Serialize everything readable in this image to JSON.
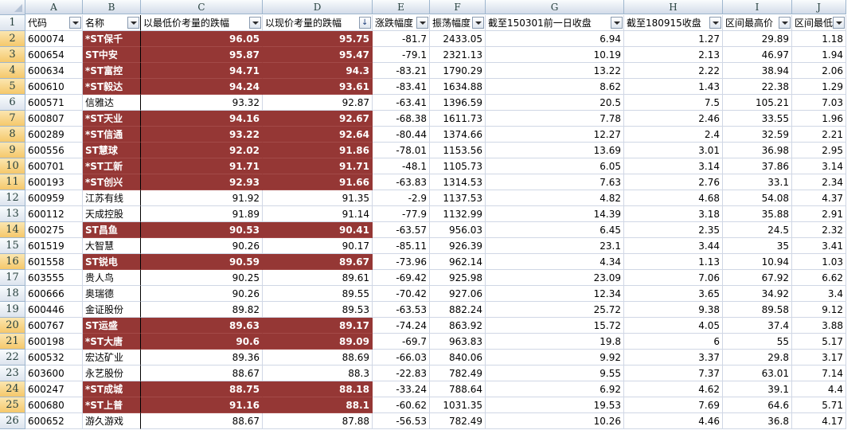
{
  "column_letters": [
    "A",
    "B",
    "C",
    "D",
    "E",
    "F",
    "G",
    "H",
    "I",
    "J"
  ],
  "headers": [
    "代码",
    "名称",
    "以最低价考量的跌幅",
    "以现价考量的跌幅",
    "涨跌幅度",
    "振荡幅度",
    "截至150301前一日收盘",
    "截至180915收盘",
    "区间最高价",
    "区间最低价"
  ],
  "header_row_number": "1",
  "sort_indicator": "↓",
  "highlight_color": "#953735",
  "rows": [
    {
      "n": "2",
      "hl": true,
      "cells": [
        "600074",
        "*ST保千",
        "96.05",
        "95.75",
        "-81.7",
        "2433.05",
        "6.94",
        "1.27",
        "29.89",
        "1.18"
      ]
    },
    {
      "n": "3",
      "hl": true,
      "cells": [
        "600654",
        "ST中安",
        "95.87",
        "95.47",
        "-79.1",
        "2321.13",
        "10.19",
        "2.13",
        "46.97",
        "1.94"
      ]
    },
    {
      "n": "4",
      "hl": true,
      "cells": [
        "600634",
        "*ST富控",
        "94.71",
        "94.3",
        "-83.21",
        "1790.29",
        "13.22",
        "2.22",
        "38.94",
        "2.06"
      ]
    },
    {
      "n": "5",
      "hl": true,
      "cells": [
        "600610",
        "*ST毅达",
        "94.24",
        "93.61",
        "-83.41",
        "1634.88",
        "8.62",
        "1.43",
        "22.38",
        "1.29"
      ]
    },
    {
      "n": "6",
      "hl": false,
      "cells": [
        "600571",
        "信雅达",
        "93.32",
        "92.87",
        "-63.41",
        "1396.59",
        "20.5",
        "7.5",
        "105.21",
        "7.03"
      ]
    },
    {
      "n": "7",
      "hl": true,
      "cells": [
        "600807",
        "*ST天业",
        "94.16",
        "92.67",
        "-68.38",
        "1611.73",
        "7.78",
        "2.46",
        "33.55",
        "1.96"
      ]
    },
    {
      "n": "8",
      "hl": true,
      "cells": [
        "600289",
        "*ST信通",
        "93.22",
        "92.64",
        "-80.44",
        "1374.66",
        "12.27",
        "2.4",
        "32.59",
        "2.21"
      ]
    },
    {
      "n": "9",
      "hl": true,
      "cells": [
        "600556",
        "ST慧球",
        "92.02",
        "91.86",
        "-78.01",
        "1153.56",
        "13.69",
        "3.01",
        "36.98",
        "2.95"
      ]
    },
    {
      "n": "10",
      "hl": true,
      "cells": [
        "600701",
        "*ST工新",
        "91.71",
        "91.71",
        "-48.1",
        "1105.73",
        "6.05",
        "3.14",
        "37.86",
        "3.14"
      ]
    },
    {
      "n": "11",
      "hl": true,
      "cells": [
        "600193",
        "*ST创兴",
        "92.93",
        "91.66",
        "-63.83",
        "1314.53",
        "7.63",
        "2.76",
        "33.1",
        "2.34"
      ]
    },
    {
      "n": "12",
      "hl": false,
      "cells": [
        "600959",
        "江苏有线",
        "91.92",
        "91.35",
        "-2.9",
        "1137.53",
        "4.82",
        "4.68",
        "54.08",
        "4.37"
      ]
    },
    {
      "n": "13",
      "hl": false,
      "cells": [
        "600112",
        "天成控股",
        "91.89",
        "91.14",
        "-77.9",
        "1132.99",
        "14.39",
        "3.18",
        "35.88",
        "2.91"
      ]
    },
    {
      "n": "14",
      "hl": true,
      "cells": [
        "600275",
        "ST昌鱼",
        "90.53",
        "90.41",
        "-63.57",
        "956.03",
        "6.45",
        "2.35",
        "24.5",
        "2.32"
      ]
    },
    {
      "n": "15",
      "hl": false,
      "cells": [
        "601519",
        "大智慧",
        "90.26",
        "90.17",
        "-85.11",
        "926.39",
        "23.1",
        "3.44",
        "35",
        "3.41"
      ]
    },
    {
      "n": "16",
      "hl": true,
      "cells": [
        "601558",
        "ST锐电",
        "90.59",
        "89.67",
        "-73.96",
        "962.14",
        "4.34",
        "1.13",
        "10.94",
        "1.03"
      ]
    },
    {
      "n": "17",
      "hl": false,
      "cells": [
        "603555",
        "贵人鸟",
        "90.25",
        "89.61",
        "-69.42",
        "925.98",
        "23.09",
        "7.06",
        "67.92",
        "6.62"
      ]
    },
    {
      "n": "18",
      "hl": false,
      "cells": [
        "600666",
        "奥瑞德",
        "90.26",
        "89.55",
        "-70.42",
        "927.06",
        "12.34",
        "3.65",
        "34.92",
        "3.4"
      ]
    },
    {
      "n": "19",
      "hl": false,
      "cells": [
        "600446",
        "金证股份",
        "89.82",
        "89.53",
        "-63.53",
        "882.24",
        "25.72",
        "9.38",
        "89.58",
        "9.12"
      ]
    },
    {
      "n": "20",
      "hl": true,
      "cells": [
        "600767",
        "ST运盛",
        "89.63",
        "89.17",
        "-74.24",
        "863.92",
        "15.72",
        "4.05",
        "37.4",
        "3.88"
      ]
    },
    {
      "n": "21",
      "hl": true,
      "cells": [
        "600198",
        "*ST大唐",
        "90.6",
        "89.09",
        "-69.7",
        "963.83",
        "19.8",
        "6",
        "55",
        "5.17"
      ]
    },
    {
      "n": "22",
      "hl": false,
      "cells": [
        "600532",
        "宏达矿业",
        "89.36",
        "88.69",
        "-66.03",
        "840.06",
        "9.92",
        "3.37",
        "29.8",
        "3.17"
      ]
    },
    {
      "n": "23",
      "hl": false,
      "cells": [
        "603600",
        "永艺股份",
        "88.67",
        "88.3",
        "-22.83",
        "782.49",
        "9.55",
        "7.37",
        "63.01",
        "7.14"
      ]
    },
    {
      "n": "24",
      "hl": true,
      "cells": [
        "600247",
        "*ST成城",
        "88.75",
        "88.18",
        "-33.24",
        "788.64",
        "6.92",
        "4.62",
        "39.1",
        "4.4"
      ]
    },
    {
      "n": "25",
      "hl": true,
      "cells": [
        "600680",
        "*ST上普",
        "91.16",
        "88.1",
        "-60.62",
        "1031.35",
        "19.53",
        "7.69",
        "64.6",
        "5.71"
      ]
    },
    {
      "n": "26",
      "hl": false,
      "cells": [
        "600652",
        "游久游戏",
        "88.67",
        "87.88",
        "-56.53",
        "782.49",
        "10.26",
        "4.46",
        "36.8",
        "4.17"
      ]
    }
  ]
}
